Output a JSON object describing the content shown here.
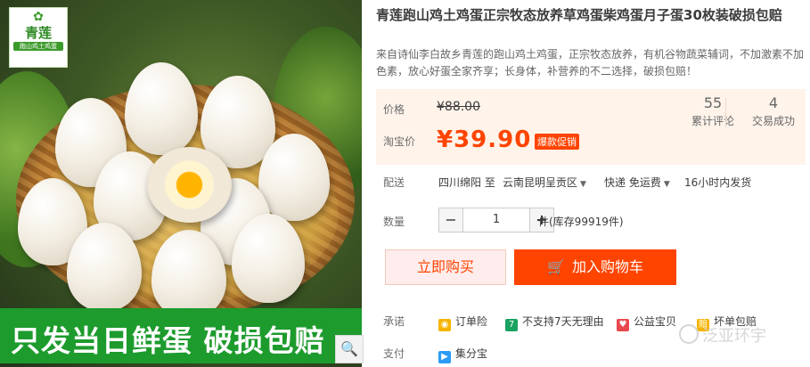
{
  "brand": {
    "name": "青莲",
    "sub": "跑山鸡土鸡蛋"
  },
  "banner": {
    "text": "只发当日鲜蛋 破损包赔"
  },
  "zoom": {
    "icon": "magnifier-icon",
    "glyph": "🔍"
  },
  "product": {
    "title": "青莲跑山鸡土鸡蛋正宗牧态放养草鸡蛋柴鸡蛋月子蛋30枚装破损包赔",
    "description": "来自诗仙李白故乡青莲的跑山鸡土鸡蛋，正宗牧态放养，有机谷物蔬菜辅词，不加激素不加色素，放心好蛋全家齐享；长身体，补营养的不二选择，破损包赔！"
  },
  "price": {
    "label": "价格",
    "original": "¥88.00",
    "promo_label": "淘宝价",
    "current": "¥39.90",
    "badge": "爆款促销"
  },
  "stats": [
    {
      "value": "55",
      "label": "累计评论"
    },
    {
      "value": "4",
      "label": "交易成功"
    }
  ],
  "shipping": {
    "label": "配送",
    "from": "四川绵阳 至",
    "to": "云南昆明呈贡区",
    "method": "快递 免运费",
    "dispatch": "16小时内发货"
  },
  "quantity": {
    "label": "数量",
    "value": "1",
    "minus": "−",
    "plus": "+",
    "stock": "件(库存99919件)"
  },
  "actions": {
    "buy_now": "立即购买",
    "add_cart": "加入购物车",
    "cart_icon": "🛒"
  },
  "promise": {
    "label": "承诺",
    "items": [
      {
        "icon": "insurance-icon",
        "glyph": "◉",
        "color": "#f5b400",
        "text": "订单险"
      },
      {
        "icon": "no-return-icon",
        "glyph": "7",
        "color": "#1aa260",
        "text": "不支持7天无理由"
      },
      {
        "icon": "charity-icon",
        "glyph": "♥",
        "color": "#e9484d",
        "text": "公益宝贝"
      },
      {
        "icon": "compensation-icon",
        "glyph": "赔",
        "color": "#f5b400",
        "text": "坏单包赔"
      }
    ]
  },
  "payment": {
    "label": "支付",
    "items": [
      {
        "icon": "google-play-icon",
        "glyph": "▶",
        "color": "#2a9cf5",
        "text": "集分宝"
      }
    ]
  },
  "watermark": {
    "text": "泛亚环宇"
  },
  "colors": {
    "accent": "#ff4400",
    "price_bg": "#fff3ea",
    "banner_green": "#1d9b2d"
  }
}
